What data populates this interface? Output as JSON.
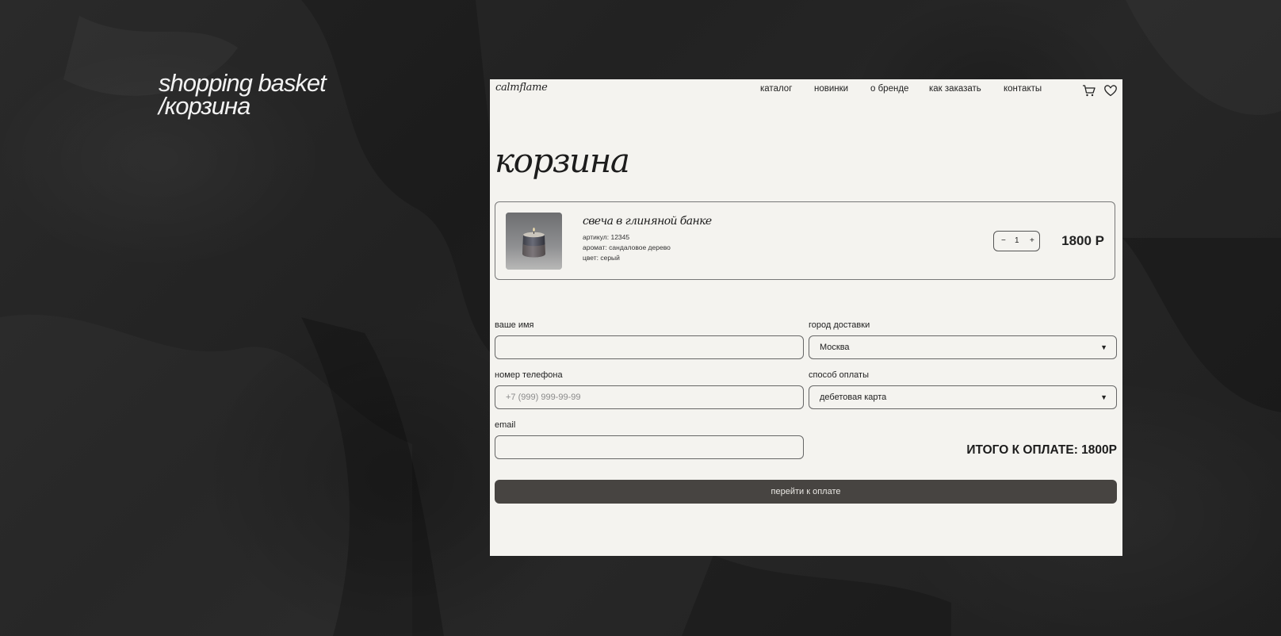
{
  "side_title": {
    "line1": "shopping basket",
    "line2": "/корзина"
  },
  "header": {
    "logo": "calmflame",
    "nav": [
      "каталог",
      "новинки",
      "о бренде",
      "как заказать",
      "контакты"
    ],
    "icons": [
      "cart-icon",
      "heart-icon"
    ]
  },
  "page_title": "корзина",
  "cart_item": {
    "name": "свеча в глиняной банке",
    "article": "артикул: 12345",
    "aroma": "аромат: сандаловое дерево",
    "color": "цвет: серый",
    "quantity": "1",
    "minus": "−",
    "plus": "+",
    "price": "1800 Р"
  },
  "form": {
    "name_label": "ваше имя",
    "name_value": "",
    "phone_label": "номер телефона",
    "phone_placeholder": "+7 (999) 999-99-99",
    "email_label": "email",
    "email_value": "",
    "city_label": "город доставки",
    "city_value": "Москва",
    "payment_label": "способ оплаты",
    "payment_value": "дебетовая карта",
    "dropdown_arrow": "▼"
  },
  "total": "ИТОГО К ОПЛАТЕ: 1800Р",
  "pay_button": "перейти к оплате",
  "colors": {
    "background": "#252525",
    "panel": "#f4f3ef",
    "button": "#474441",
    "text": "#222222"
  }
}
